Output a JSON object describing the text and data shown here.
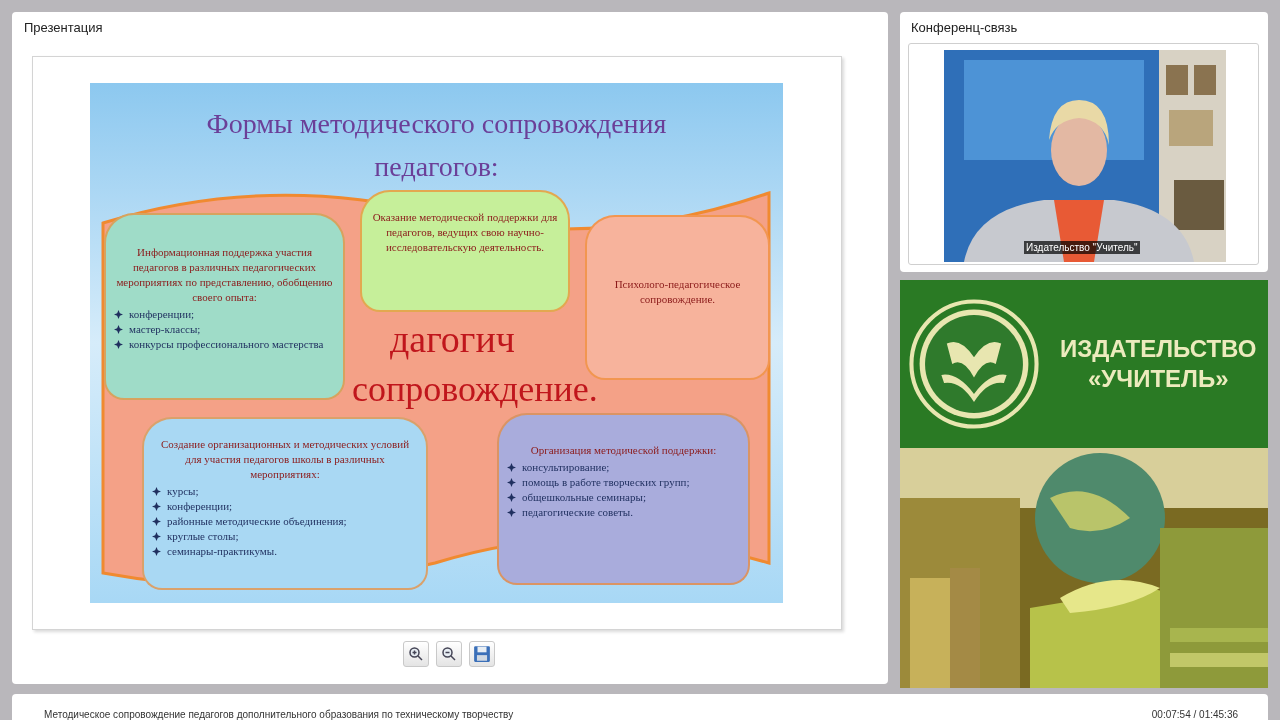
{
  "presentation": {
    "title": "Презентация",
    "slide": {
      "title_lines": [
        "Формы методического сопровождения",
        "педагогов:"
      ],
      "background_words": [
        "дагогич",
        "сопровождение."
      ],
      "boxes": [
        {
          "color": "#9fdcc8",
          "heading": "Информационная поддержка участия педагогов в различных педагогических мероприятиях по представлению, обобщению своего опыта:",
          "items": [
            "конференции;",
            "мастер-классы;",
            "конкурсы профессионального мастерства"
          ]
        },
        {
          "color": "#c6ef9a",
          "heading": "Оказание методической поддержки для педагогов, ведущих свою научно-исследовательскую деятельность."
        },
        {
          "color": "#f7b39c",
          "heading": "Психолого-педагогическое сопровождение."
        },
        {
          "color": "#a9d8f3",
          "heading": "Создание организационных и методических условий для участия педагогов школы в различных мероприятиях:",
          "items": [
            "курсы;",
            "конференции;",
            "районные методические объединения;",
            "круглые столы;",
            "семинары-практикумы."
          ]
        },
        {
          "color": "#a9acdc",
          "heading": "Организация методической поддержки:",
          "items": [
            "консультирование;",
            "помощь в работе творческих групп;",
            "общешкольные семинары;",
            "педагогические советы."
          ]
        }
      ]
    },
    "toolbar": [
      {
        "kind": "zoom-in"
      },
      {
        "kind": "zoom-out"
      },
      {
        "kind": "save"
      }
    ]
  },
  "conference": {
    "title": "Конференц-связь",
    "video_label": "Издательство \"Учитель\""
  },
  "banner": {
    "lines": [
      "ИЗДАТЕЛЬСТВО",
      "«УЧИТЕЛЬ»"
    ]
  },
  "status_bar": {
    "title": "Методическое сопровождение педагогов дополнительного образования по техническому творчеству",
    "time": "00:07:54 / 01:45:36"
  }
}
